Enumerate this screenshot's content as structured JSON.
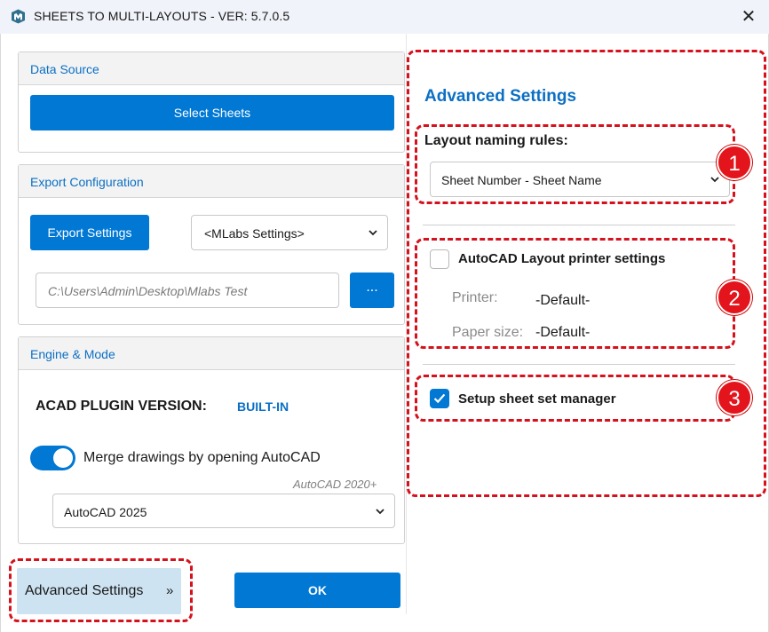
{
  "window": {
    "title": "SHEETS TO MULTI-LAYOUTS - VER: 5.7.0.5",
    "app_icon": "mlabs-logo-icon",
    "close_icon": "close-icon",
    "close_glyph": "✕"
  },
  "left": {
    "data_source": {
      "header": "Data Source",
      "select_sheets_label": "Select Sheets"
    },
    "export_configuration": {
      "header": "Export Configuration",
      "export_settings_label": "Export Settings",
      "settings_select_value": "<MLabs Settings>",
      "path_value": "C:\\Users\\Admin\\Desktop\\Mlabs Test",
      "browse_label": "..."
    },
    "engine_mode": {
      "header": "Engine & Mode",
      "plugin_version_label": "ACAD PLUGIN VERSION:",
      "plugin_version_value": "BUILT-IN",
      "merge_toggle_on": true,
      "merge_label": "Merge drawings by opening AutoCAD",
      "autocad_hint": "AutoCAD 2020+",
      "autocad_select_value": "AutoCAD 2025"
    },
    "advanced_settings_button": {
      "label": "Advanced Settings",
      "chevron": "»"
    },
    "ok_label": "OK"
  },
  "advanced": {
    "title": "Advanced Settings",
    "layout_naming": {
      "label": "Layout naming rules:",
      "select_value": "Sheet Number - Sheet Name"
    },
    "autocad_printer": {
      "checked": false,
      "label": "AutoCAD Layout printer settings",
      "printer_label": "Printer:",
      "printer_value": "-Default-",
      "paper_label": "Paper size:",
      "paper_value": "-Default-"
    },
    "sheet_set": {
      "checked": true,
      "label": "Setup sheet set manager"
    }
  },
  "annotations": {
    "badge_1": "1",
    "badge_2": "2",
    "badge_3": "3",
    "highlight_color": "#d4111c"
  },
  "colors": {
    "accent": "#0078d4",
    "header_text": "#0b6fc4",
    "advanced_button_bg": "#cde3f2"
  }
}
